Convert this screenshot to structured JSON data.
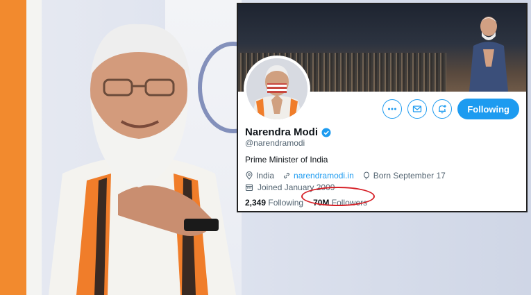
{
  "profile": {
    "name": "Narendra Modi",
    "handle": "@narendramodi",
    "bio": "Prime Minister of India",
    "location": "India",
    "website": "narendramodi.in",
    "birthday": "Born September 17",
    "joined": "Joined January 2009",
    "following_count": "2,349",
    "following_label": "Following",
    "followers_count": "70M",
    "followers_label": "Followers",
    "follow_button": "Following"
  },
  "colors": {
    "accent": "#1d9bf0",
    "highlight_ring": "#d61f26"
  },
  "icons": {
    "more": "more-icon",
    "message": "mail-icon",
    "notify": "bell-plus-icon",
    "verified": "verified-badge-icon",
    "location": "location-icon",
    "link": "link-icon",
    "birthday": "balloon-icon",
    "calendar": "calendar-icon"
  }
}
